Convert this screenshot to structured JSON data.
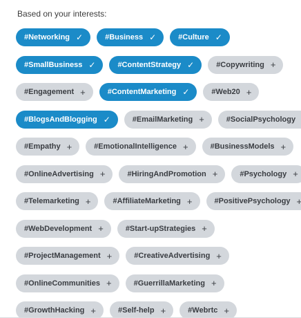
{
  "intro_text": "Based on your interests:",
  "colors": {
    "selected": "#1b8bc8",
    "unselected": "#d3d7dc"
  },
  "rows": [
    [
      {
        "label": "#Networking",
        "selected": true
      },
      {
        "label": "#Business",
        "selected": true
      },
      {
        "label": "#Culture",
        "selected": true
      }
    ],
    [
      {
        "label": "#SmallBusiness",
        "selected": true
      },
      {
        "label": "#ContentStrategy",
        "selected": true
      },
      {
        "label": "#Copywriting",
        "selected": false
      }
    ],
    [
      {
        "label": "#Engagement",
        "selected": false
      },
      {
        "label": "#ContentMarketing",
        "selected": true
      },
      {
        "label": "#Web20",
        "selected": false
      }
    ],
    [
      {
        "label": "#BlogsAndBlogging",
        "selected": true
      },
      {
        "label": "#EmailMarketing",
        "selected": false
      },
      {
        "label": "#SocialPsychology",
        "selected": false
      }
    ],
    [
      {
        "label": "#Empathy",
        "selected": false
      },
      {
        "label": "#EmotionalIntelligence",
        "selected": false
      },
      {
        "label": "#BusinessModels",
        "selected": false
      }
    ],
    [
      {
        "label": "#OnlineAdvertising",
        "selected": false
      },
      {
        "label": "#HiringAndPromotion",
        "selected": false
      },
      {
        "label": "#Psychology",
        "selected": false
      }
    ],
    [
      {
        "label": "#Telemarketing",
        "selected": false
      },
      {
        "label": "#AffiliateMarketing",
        "selected": false
      },
      {
        "label": "#PositivePsychology",
        "selected": false
      }
    ],
    [
      {
        "label": "#WebDevelopment",
        "selected": false
      },
      {
        "label": "#Start-upStrategies",
        "selected": false
      }
    ],
    [
      {
        "label": "#ProjectManagement",
        "selected": false
      },
      {
        "label": "#CreativeAdvertising",
        "selected": false
      }
    ],
    [
      {
        "label": "#OnlineCommunities",
        "selected": false
      },
      {
        "label": "#GuerrillaMarketing",
        "selected": false
      }
    ],
    [
      {
        "label": "#GrowthHacking",
        "selected": false
      },
      {
        "label": "#Self-help",
        "selected": false
      },
      {
        "label": "#Webrtc",
        "selected": false
      }
    ]
  ]
}
